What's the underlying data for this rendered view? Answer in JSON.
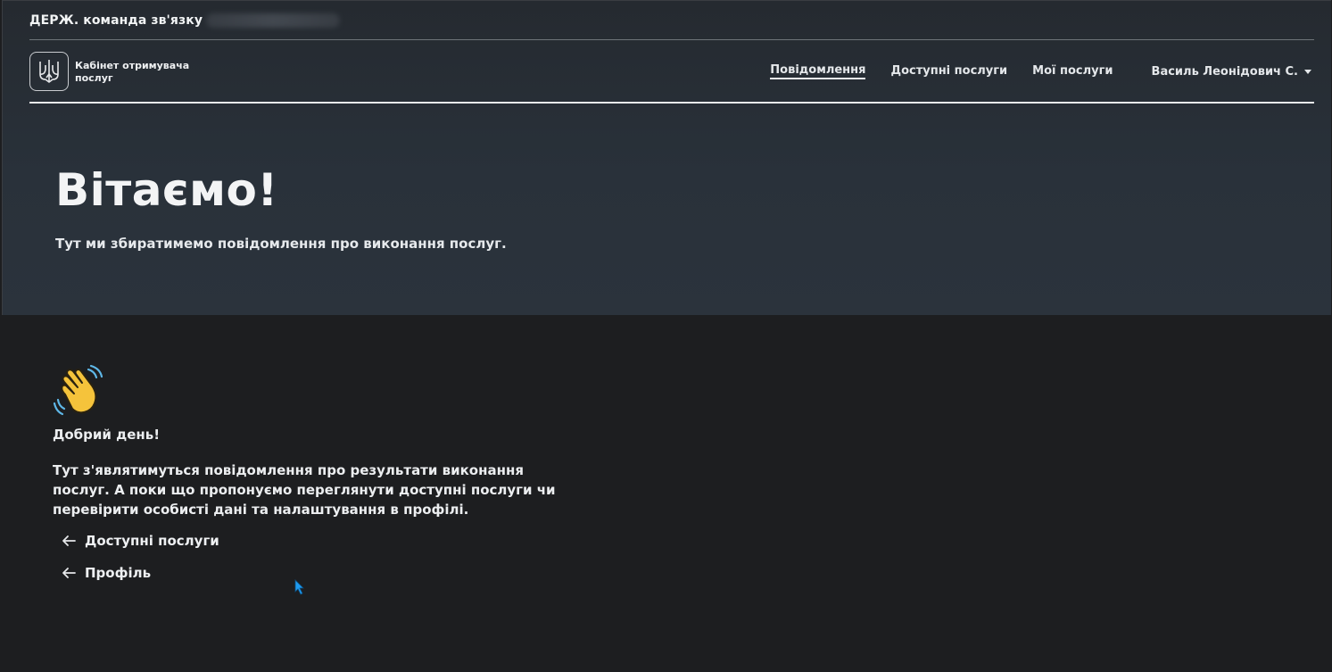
{
  "gov_bar": {
    "title": "ДЕРЖ. команда зв'язку"
  },
  "header": {
    "brand_line1": "Кабінет отримувача",
    "brand_line2": "послуг",
    "nav": [
      {
        "label": "Повідомлення",
        "active": true
      },
      {
        "label": "Доступні послуги",
        "active": false
      },
      {
        "label": "Мої послуги",
        "active": false
      }
    ],
    "user_name": "Василь Леонідович С."
  },
  "hero": {
    "title": "Вітаємо!",
    "subtitle": "Тут ми збиратимемо повідомлення про виконання послуг."
  },
  "main": {
    "greeting": "Добрий день!",
    "message": "Тут з'являтимуться повідомлення про результати виконання послуг. А поки що пропонуємо переглянути доступні послуги чи перевірити особисті дані та налаштування в профілі.",
    "links": [
      {
        "label": "Доступні послуги",
        "icon": "arrow-left-icon"
      },
      {
        "label": "Профіль",
        "icon": "arrow-left-icon"
      }
    ]
  },
  "colors": {
    "hero_bg": "#29313a",
    "page_bg": "#1d1e20",
    "text": "#e9ecef",
    "emoji_yellow": "#f5c33b",
    "cursor": "#1e9bf0"
  }
}
